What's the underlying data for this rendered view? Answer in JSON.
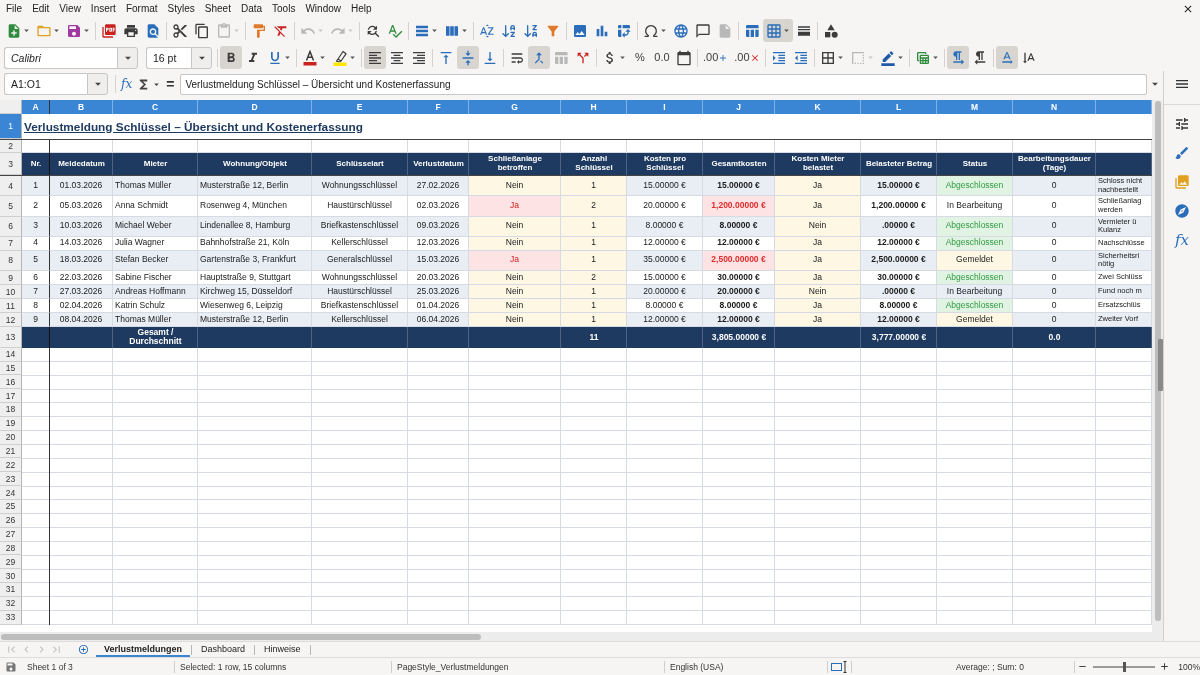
{
  "menu_bar": {
    "items": [
      "File",
      "Edit",
      "View",
      "Insert",
      "Format",
      "Styles",
      "Sheet",
      "Data",
      "Tools",
      "Window",
      "Help"
    ]
  },
  "standard_toolbar": {
    "groups": [
      [
        {
          "kind": "new",
          "active": false,
          "disabled": false,
          "dropdown": true
        },
        {
          "kind": "open",
          "active": false,
          "disabled": false,
          "dropdown": true
        },
        {
          "kind": "save",
          "active": false,
          "disabled": false,
          "dropdown": true
        }
      ],
      [
        {
          "kind": "pdf",
          "active": false,
          "disabled": false,
          "dropdown": false
        },
        {
          "kind": "print",
          "active": false,
          "disabled": false,
          "dropdown": false
        },
        {
          "kind": "preview",
          "active": false,
          "disabled": false,
          "dropdown": false
        }
      ],
      [
        {
          "kind": "cut",
          "active": false,
          "disabled": false,
          "dropdown": false
        },
        {
          "kind": "copy",
          "active": false,
          "disabled": false,
          "dropdown": false
        },
        {
          "kind": "paste",
          "active": false,
          "disabled": true,
          "dropdown": true
        }
      ],
      [
        {
          "kind": "clone",
          "active": false,
          "disabled": false,
          "dropdown": false
        },
        {
          "kind": "clear",
          "active": false,
          "disabled": false,
          "dropdown": false
        }
      ],
      [
        {
          "kind": "undo",
          "active": false,
          "disabled": true,
          "dropdown": true
        },
        {
          "kind": "redo",
          "active": false,
          "disabled": true,
          "dropdown": true
        }
      ],
      [
        {
          "kind": "find",
          "active": false,
          "disabled": false,
          "dropdown": false
        },
        {
          "kind": "spelling",
          "active": false,
          "disabled": false,
          "dropdown": false
        }
      ],
      [
        {
          "kind": "rows",
          "active": false,
          "disabled": false,
          "dropdown": true
        },
        {
          "kind": "columns",
          "active": false,
          "disabled": false,
          "dropdown": true
        }
      ],
      [
        {
          "kind": "sort",
          "active": false,
          "disabled": false,
          "dropdown": false
        },
        {
          "kind": "ascending",
          "active": false,
          "disabled": false,
          "dropdown": false
        },
        {
          "kind": "descending",
          "active": false,
          "disabled": false,
          "dropdown": false
        },
        {
          "kind": "filter",
          "active": false,
          "disabled": false,
          "dropdown": false
        }
      ],
      [
        {
          "kind": "image",
          "active": false,
          "disabled": false,
          "dropdown": false
        },
        {
          "kind": "chart",
          "active": false,
          "disabled": false,
          "dropdown": false
        },
        {
          "kind": "pivot",
          "active": false,
          "disabled": false,
          "dropdown": false
        }
      ],
      [
        {
          "kind": "special",
          "active": false,
          "disabled": false,
          "dropdown": true
        },
        {
          "kind": "hyperlink",
          "active": false,
          "disabled": false,
          "dropdown": false
        },
        {
          "kind": "comment",
          "active": false,
          "disabled": false,
          "dropdown": false
        },
        {
          "kind": "headers",
          "active": false,
          "disabled": true,
          "dropdown": false
        }
      ],
      [
        {
          "kind": "printarea",
          "active": false,
          "disabled": false,
          "dropdown": false
        },
        {
          "kind": "freeze",
          "active": true,
          "disabled": false,
          "dropdown": true
        },
        {
          "kind": "split",
          "active": false,
          "disabled": false,
          "dropdown": false
        }
      ],
      [
        {
          "kind": "shapes",
          "active": false,
          "disabled": false,
          "dropdown": false
        }
      ]
    ]
  },
  "formatting_toolbar": {
    "font_name": "Calibri",
    "font_size": "16 pt",
    "groups": [
      [
        {
          "kind": "bold",
          "active": true,
          "disabled": false,
          "dropdown": false
        },
        {
          "kind": "italic",
          "active": false,
          "disabled": false,
          "dropdown": false
        },
        {
          "kind": "underline",
          "active": false,
          "disabled": false,
          "dropdown": true
        }
      ],
      [
        {
          "kind": "fontcolor",
          "active": false,
          "disabled": false,
          "dropdown": true
        },
        {
          "kind": "highlight",
          "active": false,
          "disabled": false,
          "dropdown": true
        }
      ],
      [
        {
          "kind": "left",
          "active": true,
          "disabled": false,
          "dropdown": false
        },
        {
          "kind": "center",
          "active": false,
          "disabled": false,
          "dropdown": false
        },
        {
          "kind": "right",
          "active": false,
          "disabled": false,
          "dropdown": false
        }
      ],
      [
        {
          "kind": "top",
          "active": false,
          "disabled": false,
          "dropdown": false
        },
        {
          "kind": "middle",
          "active": true,
          "disabled": false,
          "dropdown": false
        },
        {
          "kind": "bottom",
          "active": false,
          "disabled": false,
          "dropdown": false
        }
      ],
      [
        {
          "kind": "wrap",
          "active": false,
          "disabled": false,
          "dropdown": false
        },
        {
          "kind": "mergecenter",
          "active": true,
          "disabled": false,
          "dropdown": false
        },
        {
          "kind": "merge",
          "active": false,
          "disabled": true,
          "dropdown": false
        },
        {
          "kind": "unmerge",
          "active": false,
          "disabled": false,
          "dropdown": false
        }
      ],
      [
        {
          "kind": "currency",
          "active": false,
          "disabled": false,
          "dropdown": true
        },
        {
          "kind": "percent",
          "label": "%",
          "active": false,
          "disabled": false,
          "dropdown": false
        },
        {
          "kind": "number",
          "label": "0.0",
          "active": false,
          "disabled": false,
          "dropdown": false
        },
        {
          "kind": "date",
          "active": false,
          "disabled": false,
          "dropdown": false
        }
      ],
      [
        {
          "kind": "adddecimal",
          "label": ".00",
          "active": false,
          "disabled": false,
          "dropdown": false
        },
        {
          "kind": "deldecimal",
          "label": ".00",
          "active": false,
          "disabled": false,
          "dropdown": false
        }
      ],
      [
        {
          "kind": "indent",
          "active": false,
          "disabled": false,
          "dropdown": false
        },
        {
          "kind": "outdent",
          "active": false,
          "disabled": false,
          "dropdown": false
        }
      ],
      [
        {
          "kind": "borders",
          "active": false,
          "disabled": false,
          "dropdown": true
        },
        {
          "kind": "borderstyle",
          "active": false,
          "disabled": true,
          "dropdown": true
        },
        {
          "kind": "bordercolor",
          "active": false,
          "disabled": false,
          "dropdown": true
        }
      ],
      [
        {
          "kind": "conditional",
          "active": false,
          "disabled": false,
          "dropdown": true
        }
      ],
      [
        {
          "kind": "ltr",
          "active": true,
          "disabled": false,
          "dropdown": false
        },
        {
          "kind": "rtl",
          "active": false,
          "disabled": false,
          "dropdown": false
        }
      ],
      [
        {
          "kind": "textdir",
          "active": true,
          "disabled": false,
          "dropdown": false
        },
        {
          "kind": "vertical",
          "active": false,
          "disabled": false,
          "dropdown": false
        }
      ]
    ]
  },
  "formula_bar": {
    "name_box": "A1:O1",
    "function_label": "fx",
    "equals_label": "=",
    "value": "Verlustmeldung Schlüssel – Übersicht und Kostenerfassung"
  },
  "sheet": {
    "columns": [
      {
        "letter": "A",
        "selected": true
      },
      {
        "letter": "B",
        "selected": true
      },
      {
        "letter": "C",
        "selected": true
      },
      {
        "letter": "D",
        "selected": true
      },
      {
        "letter": "E",
        "selected": true
      },
      {
        "letter": "F",
        "selected": true
      },
      {
        "letter": "G",
        "selected": true
      },
      {
        "letter": "H",
        "selected": true
      },
      {
        "letter": "I",
        "selected": true
      },
      {
        "letter": "J",
        "selected": true
      },
      {
        "letter": "K",
        "selected": true
      },
      {
        "letter": "L",
        "selected": true
      },
      {
        "letter": "M",
        "selected": true
      },
      {
        "letter": "N",
        "selected": true
      },
      {
        "selected": true
      }
    ],
    "row_headers": [
      {
        "label": "1",
        "selected": true
      },
      {
        "label": "2",
        "selected": false
      },
      {
        "label": "3",
        "selected": false
      },
      {
        "label": "4",
        "selected": false
      },
      {
        "label": "5",
        "selected": false
      },
      {
        "label": "6",
        "selected": false
      },
      {
        "label": "7",
        "selected": false
      },
      {
        "label": "8",
        "selected": false
      },
      {
        "label": "9",
        "selected": false
      },
      {
        "label": "10",
        "selected": false
      },
      {
        "label": "11",
        "selected": false
      },
      {
        "label": "12",
        "selected": false
      },
      {
        "label": "13",
        "selected": false
      },
      {
        "label": "14",
        "selected": false
      },
      {
        "label": "15",
        "selected": false
      },
      {
        "label": "16",
        "selected": false
      },
      {
        "label": "17",
        "selected": false
      },
      {
        "label": "18",
        "selected": false
      },
      {
        "label": "19",
        "selected": false
      },
      {
        "label": "20",
        "selected": false
      },
      {
        "label": "21",
        "selected": false
      },
      {
        "label": "22",
        "selected": false
      },
      {
        "label": "23",
        "selected": false
      },
      {
        "label": "24",
        "selected": false
      },
      {
        "label": "25",
        "selected": false
      },
      {
        "label": "26",
        "selected": false
      },
      {
        "label": "27",
        "selected": false
      },
      {
        "label": "28",
        "selected": false
      },
      {
        "label": "29",
        "selected": false
      },
      {
        "label": "30",
        "selected": false
      },
      {
        "label": "31",
        "selected": false
      },
      {
        "label": "32",
        "selected": false
      },
      {
        "label": "33",
        "selected": false
      }
    ],
    "title": "Verlustmeldung Schlüssel – Übersicht und Kostenerfassung",
    "table": {
      "columns": [
        "Nr.",
        "Meldedatum",
        "Mieter",
        "Wohnung/Objekt",
        "Schlüsselart",
        "Verlustdatum",
        "Schließanlage betroffen",
        "Anzahl Schlüssel",
        "Kosten pro Schlüssel",
        "Gesamtkosten",
        "Kosten Mieter belastet",
        "Belasteter Betrag",
        "Status",
        "Bearbeitungsdauer (Tage)"
      ],
      "rows": [
        {
          "cells": [
            "1",
            "01.03.2026",
            "Thomas Müller",
            "Musterstraße 12, Berlin",
            "Wohnungsschlüssel",
            "27.02.2026",
            "Nein",
            "1",
            "15.00000 €",
            "15.00000 €",
            "Ja",
            "15.00000 €",
            "Abgeschlossen",
            "0"
          ],
          "note": "Schloss nicht\nnachbestellt",
          "lock_system_affected": false,
          "high_cost": false,
          "kind": "done"
        },
        {
          "cells": [
            "2",
            "05.03.2026",
            "Anna Schmidt",
            "Rosenweg 4, München",
            "Haustürschlüssel",
            "02.03.2026",
            "Ja",
            "2",
            "20.00000 €",
            "1,200.00000 €",
            "Ja",
            "1,200.00000 €",
            "In Bearbeitung",
            "0"
          ],
          "note": "Schließanlag\nwerden",
          "lock_system_affected": true,
          "high_cost": true,
          "kind": "in_progress"
        },
        {
          "cells": [
            "3",
            "10.03.2026",
            "Michael Weber",
            "Lindenallee 8, Hamburg",
            "Briefkastenschlüssel",
            "09.03.2026",
            "Nein",
            "1",
            "8.00000 €",
            "8.00000 €",
            "Nein",
            ".00000 €",
            "Abgeschlossen",
            "0"
          ],
          "note": "Vermieter ü\nKulanz",
          "lock_system_affected": false,
          "high_cost": false,
          "kind": "done"
        },
        {
          "cells": [
            "4",
            "14.03.2026",
            "Julia Wagner",
            "Bahnhofstraße 21, Köln",
            "Kellerschlüssel",
            "12.03.2026",
            "Nein",
            "1",
            "12.00000 €",
            "12.00000 €",
            "Ja",
            "12.00000 €",
            "Abgeschlossen",
            "0"
          ],
          "note": "Nachschlüsse",
          "lock_system_affected": false,
          "high_cost": false,
          "kind": "done"
        },
        {
          "cells": [
            "5",
            "18.03.2026",
            "Stefan Becker",
            "Gartenstraße 3, Frankfurt",
            "Generalschlüssel",
            "15.03.2026",
            "Ja",
            "1",
            "35.00000 €",
            "2,500.00000 €",
            "Ja",
            "2,500.00000 €",
            "Gemeldet",
            "0"
          ],
          "note": "Sicherheitsri\nnötig",
          "lock_system_affected": true,
          "high_cost": true,
          "kind": "reported"
        },
        {
          "cells": [
            "6",
            "22.03.2026",
            "Sabine Fischer",
            "Hauptstraße 9, Stuttgart",
            "Wohnungsschlüssel",
            "20.03.2026",
            "Nein",
            "2",
            "15.00000 €",
            "30.00000 €",
            "Ja",
            "30.00000 €",
            "Abgeschlossen",
            "0"
          ],
          "note": "Zwei Schlüss",
          "lock_system_affected": false,
          "high_cost": false,
          "kind": "done"
        },
        {
          "cells": [
            "7",
            "27.03.2026",
            "Andreas Hoffmann",
            "Kirchweg 15, Düsseldorf",
            "Haustürschlüssel",
            "25.03.2026",
            "Nein",
            "1",
            "20.00000 €",
            "20.00000 €",
            "Nein",
            ".00000 €",
            "In Bearbeitung",
            "0"
          ],
          "note": "Fund noch m",
          "lock_system_affected": false,
          "high_cost": false,
          "kind": "in_progress"
        },
        {
          "cells": [
            "8",
            "02.04.2026",
            "Katrin Schulz",
            "Wiesenweg 6, Leipzig",
            "Briefkastenschlüssel",
            "01.04.2026",
            "Nein",
            "1",
            "8.00000 €",
            "8.00000 €",
            "Ja",
            "8.00000 €",
            "Abgeschlossen",
            "0"
          ],
          "note": "Ersatzschlüs",
          "lock_system_affected": false,
          "high_cost": false,
          "kind": "done"
        },
        {
          "cells": [
            "9",
            "08.04.2026",
            "Thomas Müller",
            "Musterstraße 12, Berlin",
            "Kellerschlüssel",
            "06.04.2026",
            "Nein",
            "1",
            "12.00000 €",
            "12.00000 €",
            "Ja",
            "12.00000 €",
            "Gemeldet",
            "0"
          ],
          "note": "Zweiter Vorf",
          "lock_system_affected": false,
          "high_cost": false,
          "kind": "reported"
        }
      ],
      "totals": {
        "label": "Gesamt / Durchschnitt",
        "key_count": "11",
        "total_cost": "3,805.00000 €",
        "charged_amount": "3,777.00000 €",
        "duration": "0.0"
      }
    }
  },
  "sidebar": {
    "function_label": "fx"
  },
  "sheet_navigation": [
    {
      "kind": "first",
      "disabled": true
    },
    {
      "kind": "previous",
      "disabled": true
    },
    {
      "kind": "next",
      "disabled": true
    },
    {
      "kind": "last",
      "disabled": true
    }
  ],
  "sheet_tabs": [
    {
      "label": "Verlustmeldungen",
      "selected": true
    },
    {
      "label": "Dashboard",
      "selected": false
    },
    {
      "label": "Hinweise",
      "selected": false
    }
  ],
  "status_bar": {
    "sheet": "Sheet 1 of 3",
    "selection": "Selected: 1 row, 15 columns",
    "page_style": "PageStyle_Verlustmeldungen",
    "language": "English (USA)",
    "summary": "Average: ; Sum: 0",
    "zoom": {
      "level": 0.5,
      "value": "100%"
    }
  }
}
